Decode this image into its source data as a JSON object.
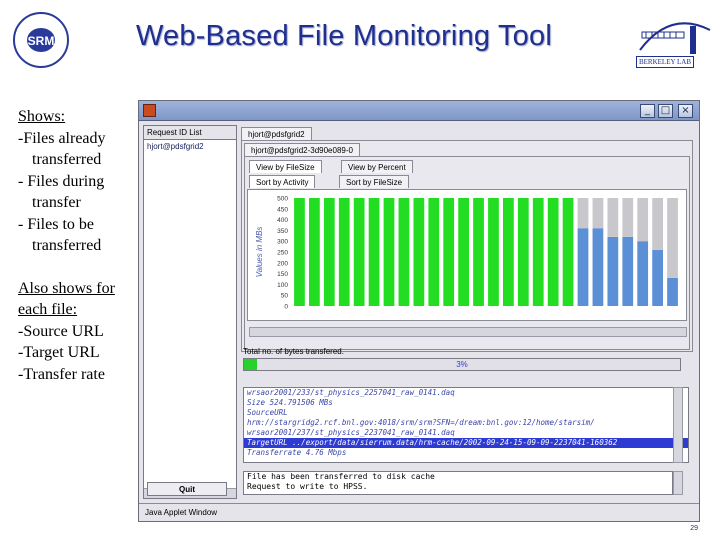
{
  "slide": {
    "title": "Web-Based File Monitoring Tool",
    "lab_logo_text": "BERKELEY LAB",
    "srm_logo_text": "SRM",
    "page_number": "29"
  },
  "notes": {
    "heading_1": "Shows:",
    "items_1": [
      "-Files already",
      "transferred",
      "- Files during",
      "transfer",
      "- Files to be",
      "transferred"
    ],
    "heading_2": "Also shows for",
    "heading_2b": "each file:",
    "items_2": [
      "-Source URL",
      "-Target URL",
      "-Transfer rate"
    ]
  },
  "window": {
    "title": "",
    "status_bar": "Java Applet Window",
    "left_pane": {
      "header": "Request ID List",
      "items": [
        "hjort@pdsfgrid2"
      ],
      "quit_label": "Quit"
    },
    "tabs": {
      "outer": "hjort@pdsfgrid2",
      "request": "hjort@pdsfgrid2-3d90e089-0",
      "view_file_size": "View by FileSize",
      "view_percent": "View by Percent",
      "sort_activity": "Sort by Activity",
      "sort_file_size": "Sort by FileSize"
    },
    "chart_ylabel": "Values in MBs",
    "bytes_label": "Total no. of bytes transfered.",
    "progress_text": "3%",
    "info_lines": [
      "wrsaor2001/233/st_physics_2257041_raw_0141.daq",
      "Size      524.791506 MBs",
      "SourceURL",
      "hrm://stargridg2.rcf.bnl.gov:4018/srm/srm?SFN=/dream:bnl.gov:12/home/starsim/",
      "wrsaor2001/237/st_physics_2237041_raw_0141.daq",
      "TargetURL      ../export/data/sierrum.data/hrm-cache/2002-09-24-15-09-09-2237041-160362",
      "Transferrate  4.76 Mbps"
    ],
    "selected_info_line": 5,
    "messages": [
      "File has been transferred to disk cache",
      "Request to write to HPSS."
    ]
  },
  "chart_data": {
    "type": "bar",
    "ylabel": "Values in MBs",
    "y_tick_labels": [
      "500",
      "450",
      "400",
      "350",
      "300",
      "250",
      "200",
      "150",
      "100",
      "50",
      "0"
    ],
    "series": [
      {
        "name": "",
        "values": [
          500,
          500,
          500,
          500,
          500,
          500,
          500,
          500,
          500,
          500,
          500,
          500,
          500,
          500,
          500,
          500,
          500,
          500,
          500,
          0,
          0,
          0,
          0,
          0,
          0,
          0
        ],
        "color": "#22dd22"
      },
      {
        "name": "",
        "values": [
          0,
          0,
          0,
          0,
          0,
          0,
          0,
          0,
          0,
          0,
          0,
          0,
          0,
          0,
          0,
          0,
          0,
          0,
          0,
          360,
          360,
          320,
          320,
          300,
          260,
          130
        ],
        "color": "#5b8fd6"
      },
      {
        "name": "",
        "values": [
          0,
          0,
          0,
          0,
          0,
          0,
          0,
          0,
          0,
          0,
          0,
          0,
          0,
          0,
          0,
          0,
          0,
          0,
          0,
          140,
          140,
          180,
          180,
          200,
          240,
          370
        ],
        "color": "#c8c8cc"
      }
    ],
    "stacked": true,
    "ylim": [
      0,
      500
    ]
  }
}
